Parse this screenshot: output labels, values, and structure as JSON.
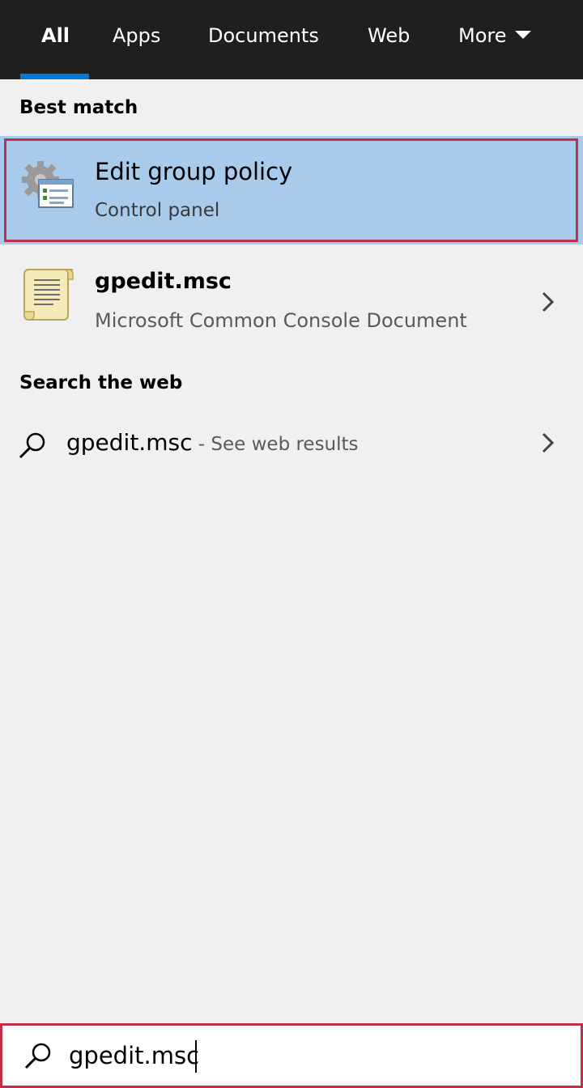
{
  "tabs": [
    {
      "label": "All",
      "active": true
    },
    {
      "label": "Apps",
      "active": false
    },
    {
      "label": "Documents",
      "active": false
    },
    {
      "label": "Web",
      "active": false
    },
    {
      "label": "More",
      "active": false
    }
  ],
  "sections": {
    "best_match": "Best match",
    "search_web": "Search the web"
  },
  "best_match_item": {
    "title": "Edit group policy",
    "subtitle": "Control panel",
    "icon": "group-policy-icon"
  },
  "results": [
    {
      "title": "gpedit.msc",
      "subtitle": "Microsoft Common Console Document",
      "icon": "document-icon"
    }
  ],
  "web_result": {
    "query": "gpedit.msc",
    "suffix": " - See web results",
    "icon": "search-icon"
  },
  "search_box": {
    "value": "gpedit.msc",
    "icon": "search-icon"
  },
  "colors": {
    "tabbar_bg": "#1f1f1f",
    "accent": "#0078d7",
    "highlight_bg": "#a8cbec",
    "focus_border": "#c0304a",
    "panel_bg": "#f0f0f0"
  }
}
